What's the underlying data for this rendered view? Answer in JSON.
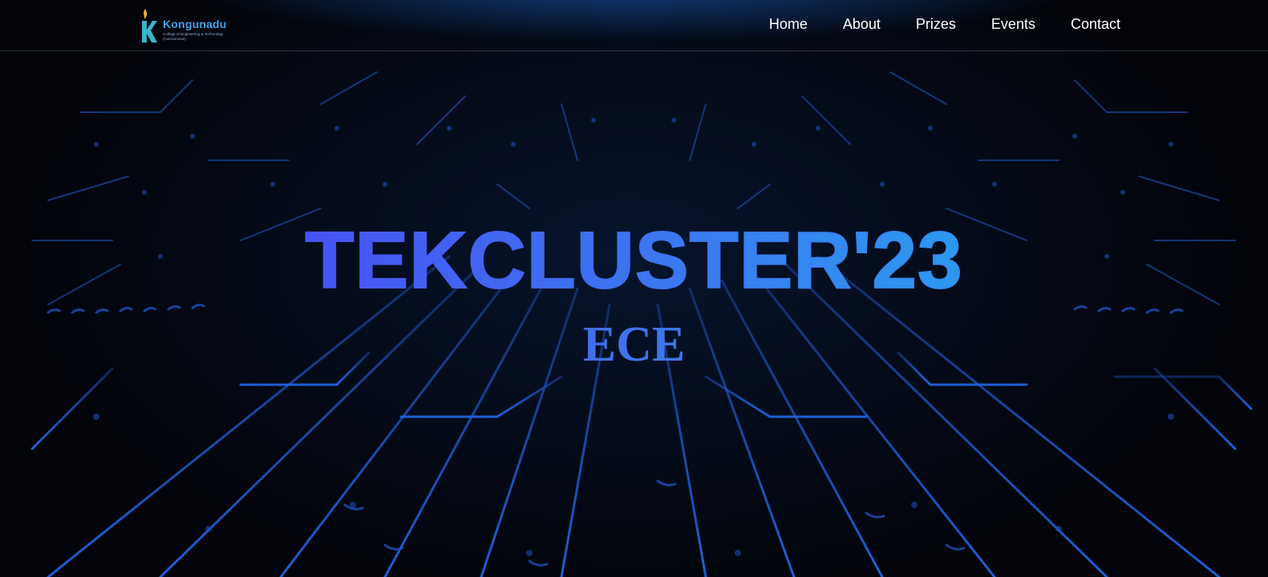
{
  "header": {
    "logo": {
      "name": "Kongunadu",
      "tagline": "College of Engineering & Technology",
      "status": "(Autonomous)"
    },
    "nav": [
      {
        "label": "Home"
      },
      {
        "label": "About"
      },
      {
        "label": "Prizes"
      },
      {
        "label": "Events"
      },
      {
        "label": "Contact"
      }
    ]
  },
  "hero": {
    "title": "TEKCLUSTER'23",
    "subtitle": "ECE"
  },
  "colors": {
    "background": "#02040a",
    "circuit_blue": "#1f5fd8",
    "title_gradient_start": "#4f35f5",
    "title_gradient_end": "#29b3ee",
    "nav_text": "#ffffff",
    "logo_text": "#3fa3e6"
  },
  "icons": {
    "logo_mark": "kongunadu-flame-k-logo-icon"
  }
}
